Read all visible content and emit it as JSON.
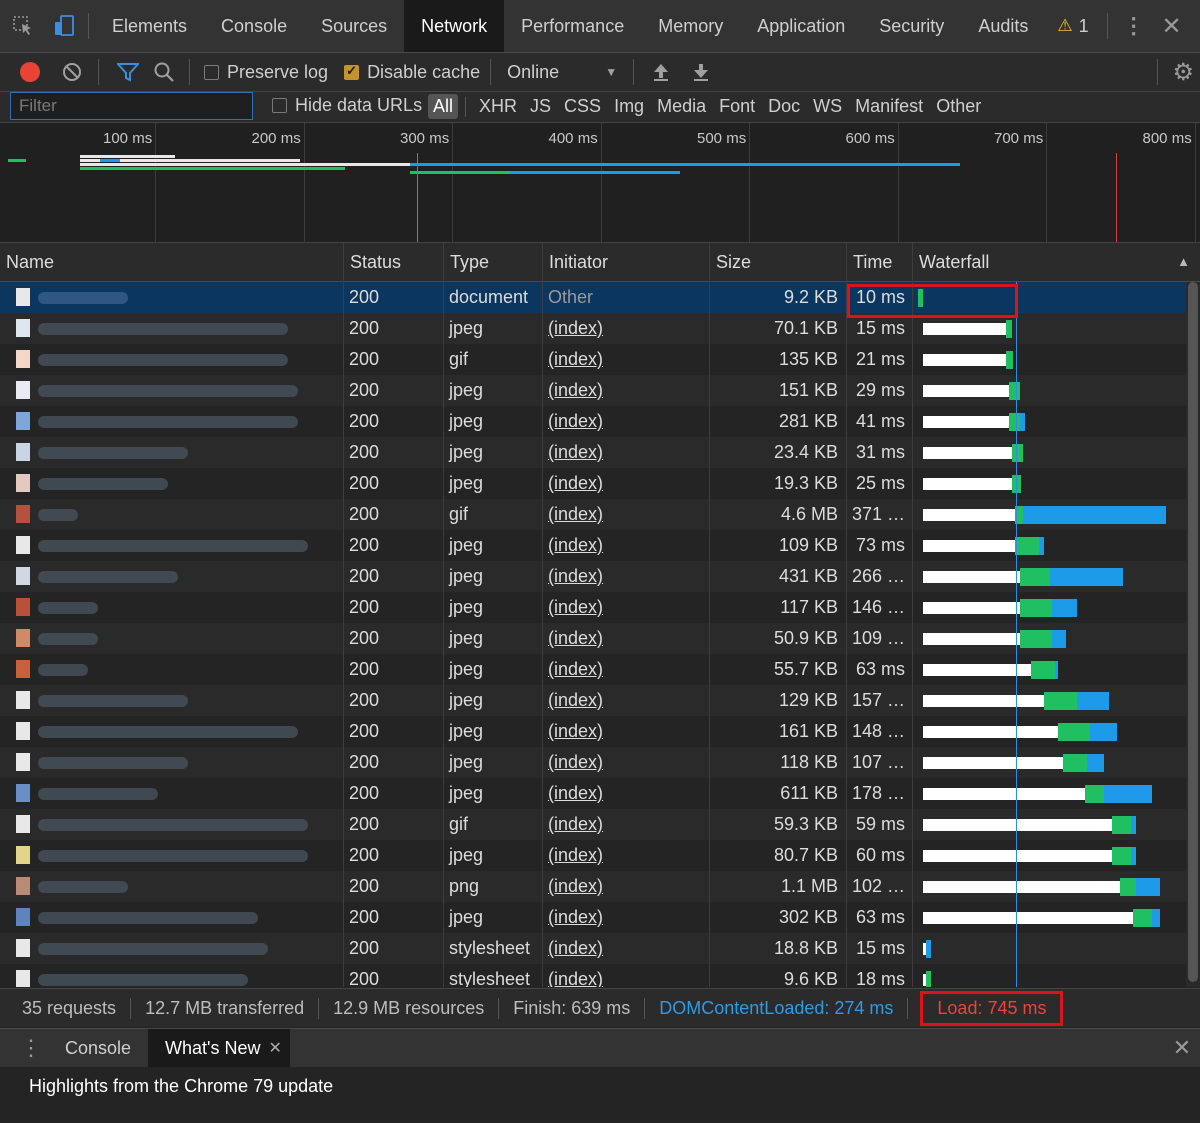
{
  "tabs": {
    "items": [
      "Elements",
      "Console",
      "Sources",
      "Network",
      "Performance",
      "Memory",
      "Application",
      "Security",
      "Audits"
    ],
    "active": "Network",
    "warning_count": "1"
  },
  "toolbar": {
    "preserve_log": "Preserve log",
    "disable_cache": "Disable cache",
    "throttle": "Online"
  },
  "filter": {
    "placeholder": "Filter",
    "hide_data_urls": "Hide data URLs",
    "types": [
      "All",
      "XHR",
      "JS",
      "CSS",
      "Img",
      "Media",
      "Font",
      "Doc",
      "WS",
      "Manifest",
      "Other"
    ],
    "active_type": "All"
  },
  "overview": {
    "ticks": [
      "100 ms",
      "200 ms",
      "300 ms",
      "400 ms",
      "500 ms",
      "600 ms",
      "700 ms",
      "800 ms"
    ]
  },
  "columns": [
    "Name",
    "Status",
    "Type",
    "Initiator",
    "Size",
    "Time",
    "Waterfall"
  ],
  "rows": [
    {
      "status": "200",
      "type": "document",
      "initiator": "Other",
      "size": "9.2 KB",
      "time": "10 ms",
      "wait": 0.0,
      "recv": 0.02,
      "dl": 0.0,
      "start": 0.0
    },
    {
      "status": "200",
      "type": "jpeg",
      "initiator": "(index)",
      "size": "70.1 KB",
      "time": "15 ms",
      "start": 0.08,
      "wait": 0.31,
      "recv": 0.02,
      "dl": 0.0
    },
    {
      "status": "200",
      "type": "gif",
      "initiator": "(index)",
      "size": "135 KB",
      "time": "21 ms",
      "start": 0.08,
      "wait": 0.31,
      "recv": 0.025,
      "dl": 0.0
    },
    {
      "status": "200",
      "type": "jpeg",
      "initiator": "(index)",
      "size": "151 KB",
      "time": "29 ms",
      "start": 0.08,
      "wait": 0.32,
      "recv": 0.04,
      "dl": 0.0
    },
    {
      "status": "200",
      "type": "jpeg",
      "initiator": "(index)",
      "size": "281 KB",
      "time": "41 ms",
      "start": 0.08,
      "wait": 0.32,
      "recv": 0.04,
      "dl": 0.02
    },
    {
      "status": "200",
      "type": "jpeg",
      "initiator": "(index)",
      "size": "23.4 KB",
      "time": "31 ms",
      "start": 0.08,
      "wait": 0.33,
      "recv": 0.04,
      "dl": 0.0
    },
    {
      "status": "200",
      "type": "jpeg",
      "initiator": "(index)",
      "size": "19.3 KB",
      "time": "25 ms",
      "start": 0.08,
      "wait": 0.33,
      "recv": 0.035,
      "dl": 0.0
    },
    {
      "status": "200",
      "type": "gif",
      "initiator": "(index)",
      "size": "4.6 MB",
      "time": "371 …",
      "start": 0.08,
      "wait": 0.34,
      "recv": 0.03,
      "dl": 0.53
    },
    {
      "status": "200",
      "type": "jpeg",
      "initiator": "(index)",
      "size": "109 KB",
      "time": "73 ms",
      "start": 0.08,
      "wait": 0.34,
      "recv": 0.09,
      "dl": 0.02
    },
    {
      "status": "200",
      "type": "jpeg",
      "initiator": "(index)",
      "size": "431 KB",
      "time": "266 …",
      "start": 0.08,
      "wait": 0.36,
      "recv": 0.11,
      "dl": 0.27
    },
    {
      "status": "200",
      "type": "jpeg",
      "initiator": "(index)",
      "size": "117 KB",
      "time": "146 …",
      "start": 0.08,
      "wait": 0.36,
      "recv": 0.12,
      "dl": 0.09
    },
    {
      "status": "200",
      "type": "jpeg",
      "initiator": "(index)",
      "size": "50.9 KB",
      "time": "109 …",
      "start": 0.08,
      "wait": 0.36,
      "recv": 0.12,
      "dl": 0.05
    },
    {
      "status": "200",
      "type": "jpeg",
      "initiator": "(index)",
      "size": "55.7 KB",
      "time": "63 ms",
      "start": 0.08,
      "wait": 0.4,
      "recv": 0.09,
      "dl": 0.01
    },
    {
      "status": "200",
      "type": "jpeg",
      "initiator": "(index)",
      "size": "129 KB",
      "time": "157 …",
      "start": 0.08,
      "wait": 0.45,
      "recv": 0.12,
      "dl": 0.12
    },
    {
      "status": "200",
      "type": "jpeg",
      "initiator": "(index)",
      "size": "161 KB",
      "time": "148 …",
      "start": 0.08,
      "wait": 0.5,
      "recv": 0.12,
      "dl": 0.1
    },
    {
      "status": "200",
      "type": "jpeg",
      "initiator": "(index)",
      "size": "118 KB",
      "time": "107 …",
      "start": 0.08,
      "wait": 0.52,
      "recv": 0.09,
      "dl": 0.06
    },
    {
      "status": "200",
      "type": "jpeg",
      "initiator": "(index)",
      "size": "611 KB",
      "time": "178 …",
      "start": 0.08,
      "wait": 0.6,
      "recv": 0.07,
      "dl": 0.18
    },
    {
      "status": "200",
      "type": "gif",
      "initiator": "(index)",
      "size": "59.3 KB",
      "time": "59 ms",
      "start": 0.08,
      "wait": 0.7,
      "recv": 0.07,
      "dl": 0.02
    },
    {
      "status": "200",
      "type": "jpeg",
      "initiator": "(index)",
      "size": "80.7 KB",
      "time": "60 ms",
      "start": 0.08,
      "wait": 0.7,
      "recv": 0.07,
      "dl": 0.02
    },
    {
      "status": "200",
      "type": "png",
      "initiator": "(index)",
      "size": "1.1 MB",
      "time": "102 …",
      "start": 0.08,
      "wait": 0.73,
      "recv": 0.06,
      "dl": 0.09
    },
    {
      "status": "200",
      "type": "jpeg",
      "initiator": "(index)",
      "size": "302 KB",
      "time": "63 ms",
      "start": 0.08,
      "wait": 0.78,
      "recv": 0.07,
      "dl": 0.03
    },
    {
      "status": "200",
      "type": "stylesheet",
      "initiator": "(index)",
      "size": "18.8 KB",
      "time": "15 ms",
      "start": 0.08,
      "wait": 0.01,
      "recv": 0.0,
      "dl": 0.02
    },
    {
      "status": "200",
      "type": "stylesheet",
      "initiator": "(index)",
      "size": "9.6 KB",
      "time": "18 ms",
      "start": 0.08,
      "wait": 0.01,
      "recv": 0.02,
      "dl": 0.0
    }
  ],
  "status_bar": {
    "requests": "35 requests",
    "transferred": "12.7 MB transferred",
    "resources": "12.9 MB resources",
    "finish": "Finish: 639 ms",
    "dom_loaded": "DOMContentLoaded: 274 ms",
    "load": "Load: 745 ms"
  },
  "drawer": {
    "tabs": [
      "Console",
      "What's New"
    ],
    "active": "What's New",
    "headline": "Highlights from the Chrome 79 update"
  },
  "colors": {
    "selected_row": "#0b3660",
    "waiting": "#1fbf62",
    "download": "#1e9be8",
    "dom_line": "#2f8fdc",
    "load_line": "#d9413a",
    "highlight_box": "#d9141b",
    "warning": "#f4c430"
  }
}
